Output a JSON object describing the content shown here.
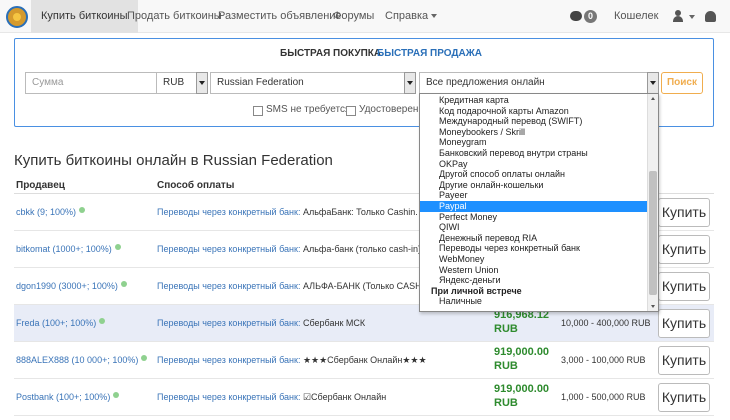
{
  "nav": {
    "items": [
      "Купить биткоины",
      "Продать биткоины",
      "Разместить объявление",
      "Форумы",
      "Справка"
    ],
    "chat_badge": "0",
    "wallet": "Кошелек"
  },
  "panel": {
    "tab_buy": "БЫСТРАЯ ПОКУПКА",
    "tab_sell": "БЫСТРАЯ ПРОДАЖА",
    "amount_placeholder": "Сумма",
    "currency": "RUB",
    "country": "Russian Federation",
    "offer_filter": "Все предложения онлайн",
    "search_label": "Поиск",
    "sms_label": "SMS не требуется",
    "id_label": "Удостоверение"
  },
  "page_title": "Купить биткоины онлайн в Russian Federation",
  "table": {
    "headers": {
      "seller": "Продавец",
      "method": "Способ оплаты"
    },
    "buy_label": "Купить",
    "rows": [
      {
        "seller": "cbkk (9; 100%)",
        "method_link": "Переводы через конкретный банк:",
        "method_desc": "АльфаБанк: Только Cashin. Сб",
        "price": "",
        "currency": "",
        "limits": ""
      },
      {
        "seller": "bitkomat (1000+; 100%)",
        "method_link": "Переводы через конкретный банк:",
        "method_desc": "Альфа-банк (только cash-in)",
        "price": "",
        "currency": "",
        "limits": ""
      },
      {
        "seller": "dgon1990 (3000+; 100%)",
        "method_link": "Переводы через конкретный банк:",
        "method_desc": "АЛЬФА-БАНК (Только CASH-IN",
        "price": "",
        "currency": "",
        "limits": ""
      },
      {
        "seller": "Freda (100+; 100%)",
        "method_link": "Переводы через конкретный банк:",
        "method_desc": "Сбербанк МСК",
        "price": "916,968.12",
        "currency": "RUB",
        "limits": "10,000 - 400,000 RUB"
      },
      {
        "seller": "888ALEX888 (10 000+; 100%)",
        "method_link": "Переводы через конкретный банк:",
        "method_desc": "★★★Сбербанк Онлайн★★★",
        "price": "919,000.00",
        "currency": "RUB",
        "limits": "3,000 - 100,000 RUB"
      },
      {
        "seller": "Postbank (100+; 100%)",
        "method_link": "Переводы через конкретный банк:",
        "method_desc": "☑Сбербанк Онлайн",
        "price": "919,000.00",
        "currency": "RUB",
        "limits": "1,000 - 500,000 RUB"
      }
    ]
  },
  "dropdown": {
    "items": [
      "Кредитная карта",
      "Код подарочной карты Amazon",
      "Международный перевод (SWIFT)",
      "Moneybookers / Skrill",
      "Moneygram",
      "Банковский перевод внутри страны",
      "OKPay",
      "Другой способ оплаты онлайн",
      "Другие онлайн-кошельки",
      "Payeer",
      "Paypal",
      "Perfect Money",
      "QIWI",
      "Денежный перевод RIA",
      "Переводы через конкретный банк",
      "WebMoney",
      "Western Union",
      "Яндекс-деньги",
      "При личной встрече",
      "Наличные"
    ],
    "selected": "Paypal",
    "group_header": "При личной встрече"
  },
  "colors": {
    "link": "#3a74b8",
    "price": "#2e8b2e",
    "accent": "#f0ad4e",
    "selected": "#1e90ff",
    "highlight_row": "#e8ecf7"
  }
}
